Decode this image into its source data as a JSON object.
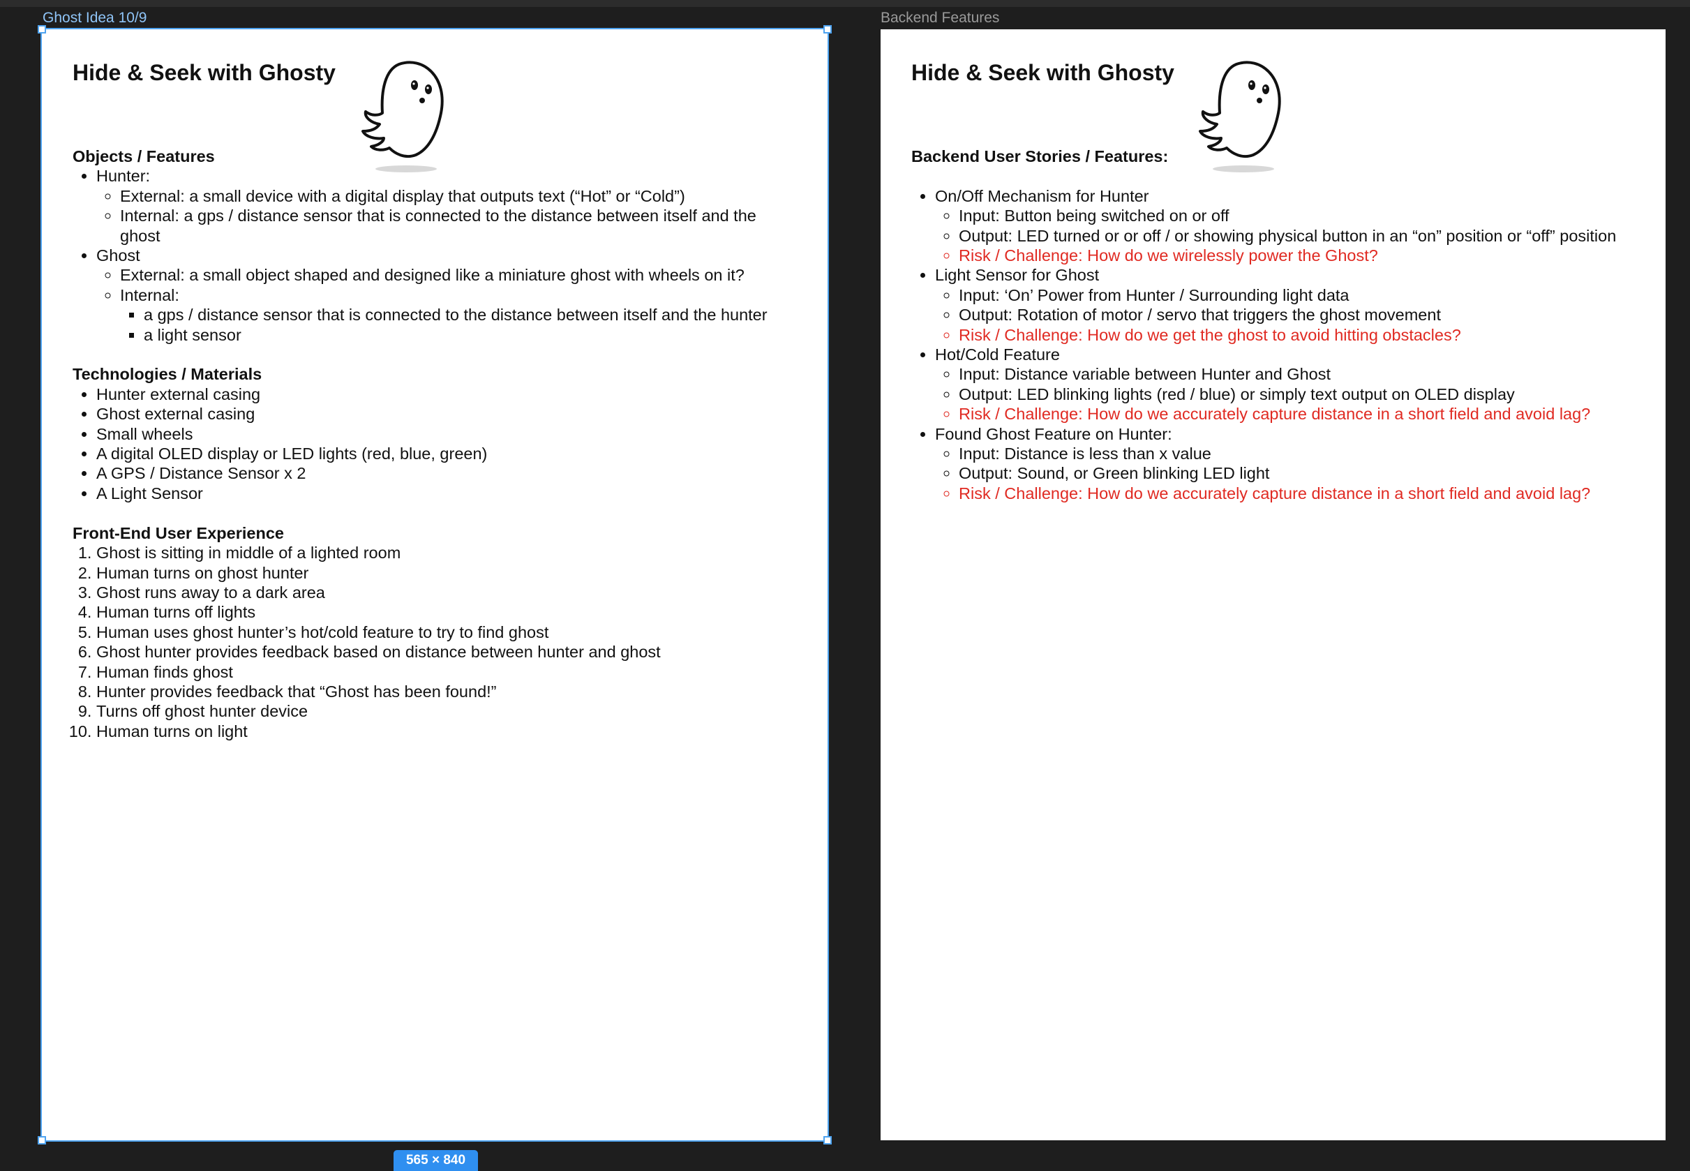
{
  "canvas": {
    "left_frame_label": "Ghost Idea 10/9",
    "right_frame_label": "Backend Features",
    "selection_size": "565 × 840"
  },
  "left_doc": {
    "title": "Hide & Seek with Ghosty",
    "objects_heading": "Objects / Features",
    "hunter": {
      "label": "Hunter:",
      "external": "External: a small device with a digital display that outputs text (“Hot” or “Cold”)",
      "internal": "Internal: a gps / distance sensor that is connected to the distance between itself and the ghost"
    },
    "ghost": {
      "label": "Ghost",
      "external": "External: a small object shaped and designed like a miniature ghost with wheels on it?",
      "internal_label": "Internal:",
      "internal_items": [
        "a gps / distance sensor that is connected to the distance between itself and the hunter",
        "a light sensor"
      ]
    },
    "tech_heading": "Technologies / Materials",
    "tech_items": [
      "Hunter external casing",
      "Ghost external casing",
      "Small wheels",
      "A digital OLED display or LED lights (red, blue, green)",
      "A GPS / Distance Sensor x 2",
      "A Light Sensor"
    ],
    "ux_heading": "Front-End User Experience",
    "ux_steps": [
      "Ghost is sitting in middle of a lighted room",
      "Human turns on ghost hunter",
      "Ghost runs away to a dark area",
      "Human turns off lights",
      "Human uses ghost hunter’s hot/cold feature to try to find ghost",
      "Ghost hunter provides feedback based on distance between hunter and ghost",
      "Human finds ghost",
      "Hunter provides feedback that “Ghost has been found!”",
      "Turns off ghost hunter device",
      "Human turns on light"
    ]
  },
  "right_doc": {
    "title": "Hide & Seek with Ghosty",
    "heading": "Backend User Stories / Features:",
    "features": [
      {
        "label": "On/Off Mechanism for Hunter",
        "input": "Input: Button being switched on or off",
        "output": "Output: LED turned or or off / or showing physical button in an “on” position or “off” position",
        "risk": "Risk / Challenge: How do we wirelessly power the Ghost?"
      },
      {
        "label": "Light Sensor for Ghost",
        "input": "Input: ‘On’ Power from Hunter / Surrounding light data",
        "output": "Output: Rotation of motor / servo that triggers the ghost movement",
        "risk": "Risk / Challenge: How do we get the ghost to avoid hitting obstacles?"
      },
      {
        "label": "Hot/Cold Feature",
        "input": "Input: Distance variable between Hunter and Ghost",
        "output": "Output: LED blinking lights (red / blue) or simply text output on OLED display",
        "risk": "Risk / Challenge: How do we accurately capture distance in a short field and avoid lag?"
      },
      {
        "label": "Found Ghost Feature on Hunter:",
        "input": "Input: Distance is less than x value",
        "output": "Output: Sound, or Green blinking LED light",
        "risk": "Risk / Challenge: How do we accurately capture distance in a short field and avoid lag?"
      }
    ]
  },
  "colors": {
    "canvas_bg": "#1e1e1e",
    "selection": "#4ea3f0",
    "risk_text": "#e02a22",
    "page_bg": "#ffffff"
  },
  "icons": [
    "ghost-icon"
  ]
}
